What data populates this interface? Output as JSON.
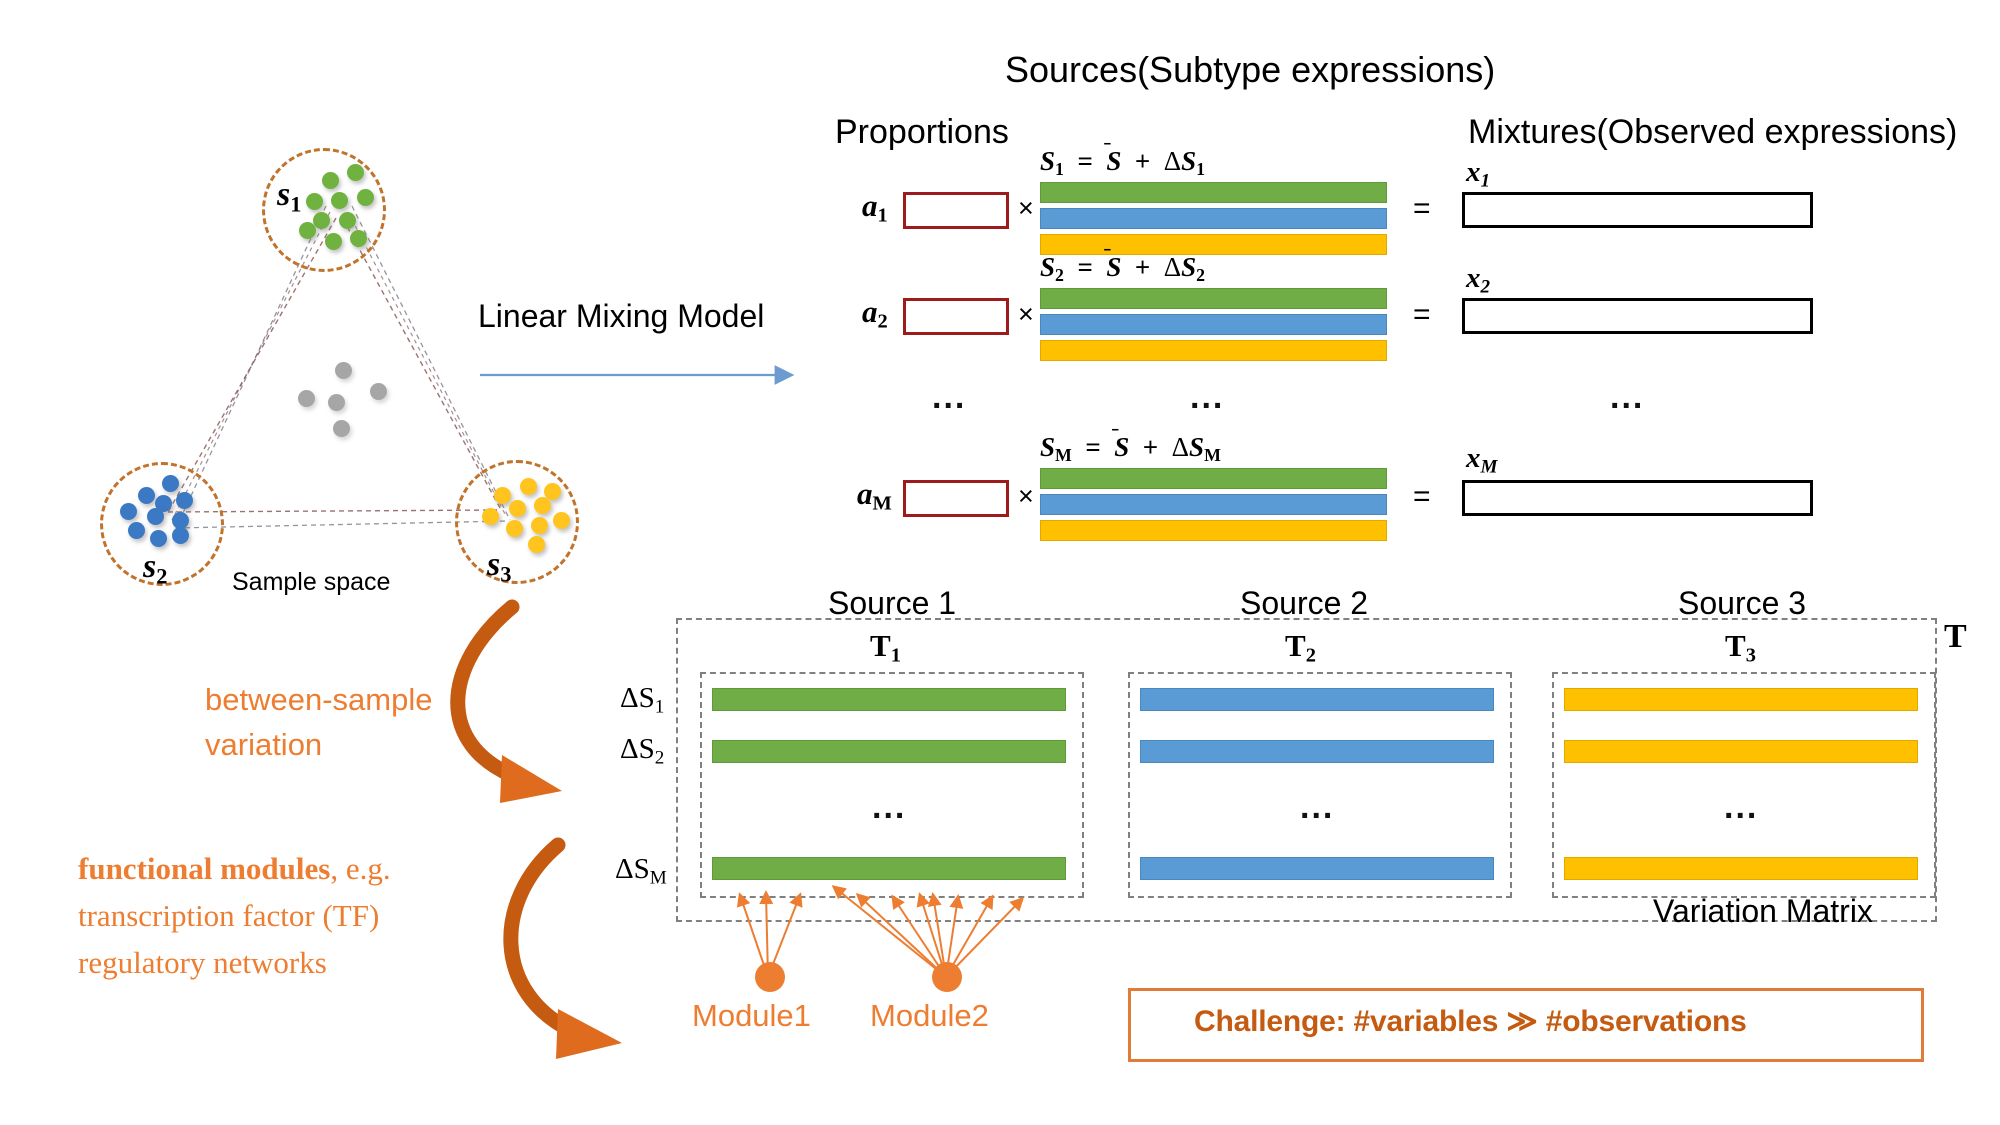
{
  "titles": {
    "sources": "Sources(Subtype expressions)",
    "proportions": "Proportions",
    "mixtures": "Mixtures(Observed expressions)",
    "linear_mixing_model": "Linear Mixing Model",
    "sample_space": "Sample space",
    "variation_matrix": "Variation Matrix",
    "matrix_symbol": "T"
  },
  "scatter": {
    "cluster_labels": [
      "s",
      "s",
      "s"
    ],
    "cluster_subscripts": [
      "1",
      "2",
      "3"
    ],
    "cluster_colors": [
      "#6FB23F",
      "#3B79C4",
      "#FFC51E"
    ],
    "circle_color": "#C1722B",
    "center_dot_color": "#A6A6A6",
    "center_dot_count": 5
  },
  "equations": {
    "rows": [
      {
        "proportion": "a",
        "proportion_sub": "1",
        "times": "×",
        "source_eq_prefix": "S",
        "source_eq_sub": "1",
        "equals": "=",
        "mixture": "x",
        "mixture_sub": "1"
      },
      {
        "proportion": "a",
        "proportion_sub": "2",
        "times": "×",
        "source_eq_prefix": "S",
        "source_eq_sub": "2",
        "equals": "=",
        "mixture": "x",
        "mixture_sub": "2"
      },
      {
        "proportion": "a",
        "proportion_sub": "M",
        "times": "×",
        "source_eq_prefix": "S",
        "source_eq_sub": "M",
        "equals": "=",
        "mixture": "x",
        "mixture_sub": "M"
      }
    ],
    "ellipsis": "...",
    "eq_mid": "=",
    "eq_mean": "S",
    "eq_plus": "+",
    "eq_delta": "Δ"
  },
  "annotations": {
    "between_sample_variation": "between-sample\nvariation",
    "between_sample_line1": "between-sample",
    "between_sample_line2": "variation",
    "functional_modules_line1": "functional modules, e.g.",
    "functional_modules_line2": "transcription factor (TF)",
    "functional_modules_line3": "regulatory networks",
    "functional_modules_bold": "functional modules",
    "arrow_color": "#C55A11"
  },
  "variation_matrix": {
    "sources": [
      {
        "title": "Source 1",
        "symbol": "T",
        "symbol_sub": "1",
        "color": "#70AD47"
      },
      {
        "title": "Source 2",
        "symbol": "T",
        "symbol_sub": "2",
        "color": "#5B9BD5"
      },
      {
        "title": "Source 3",
        "symbol": "T",
        "symbol_sub": "3",
        "color": "#FFC000"
      }
    ],
    "row_labels": [
      {
        "delta": "ΔS",
        "sub": "1"
      },
      {
        "delta": "ΔS",
        "sub": "2"
      },
      {
        "delta": "ΔS",
        "sub": "M"
      }
    ],
    "ellipsis": "...",
    "modules": [
      {
        "label": "Module1",
        "arrows": 3
      },
      {
        "label": "Module2",
        "arrows": 7
      }
    ],
    "module_color": "#ED7D31"
  },
  "challenge": {
    "text": "Challenge: #variables ≫ #observations",
    "border_color": "#E07B39",
    "text_color": "#C55A11"
  },
  "colors": {
    "green": "#70AD47",
    "blue": "#5B9BD5",
    "yellow": "#FFC000",
    "red_box": "#9E1B1B",
    "orange": "#ED7D31",
    "grey_dash": "#808080",
    "arrow_blue": "#6C9BD2"
  }
}
